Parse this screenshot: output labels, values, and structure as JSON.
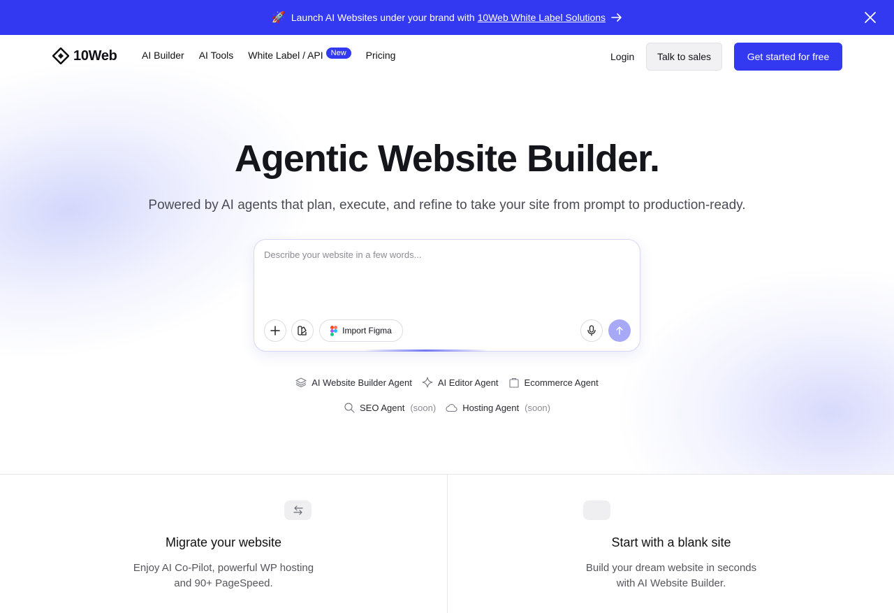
{
  "promo": {
    "text": "Launch AI Websites under your brand with",
    "link": "10Web White Label Solutions",
    "rocket": "🚀"
  },
  "nav": {
    "brand": "10Web",
    "links": [
      "AI Builder",
      "AI Tools",
      "White Label / API",
      "Pricing"
    ],
    "badge": "New",
    "login": "Login",
    "talk_to_sales": "Talk to sales",
    "get_started": "Get started for free"
  },
  "hero": {
    "title": "Agentic Website Builder.",
    "subtitle": "Powered by AI agents that plan, execute, and refine to take your site from prompt to production-ready."
  },
  "prompt": {
    "placeholder": "Describe your website in a few words...",
    "import_figma": "Import Figma"
  },
  "agents": {
    "row1": [
      "AI Website Builder Agent",
      "AI Editor Agent",
      "Ecommerce Agent"
    ],
    "row2": [
      "SEO Agent",
      "Hosting Agent"
    ],
    "soon": "(soon)"
  },
  "cards": [
    {
      "title": "Migrate your website",
      "desc_line1": "Enjoy AI Co-Pilot, powerful WP hosting",
      "desc_line2": "and 90+ PageSpeed."
    },
    {
      "title": "Start with a blank site",
      "desc_line1": "Build your dream website in seconds",
      "desc_line2": "with AI Website Builder."
    }
  ],
  "colors": {
    "accent": "#3339f1",
    "send_button": "#a7a9f6"
  },
  "icons": [
    "rocket-icon",
    "arrow-right-icon",
    "close-icon",
    "logo-icon",
    "plus-icon",
    "palette-icon",
    "figma-icon",
    "microphone-icon",
    "arrow-up-icon",
    "layers-icon",
    "sparkle-icon",
    "shopping-bag-icon",
    "search-icon",
    "cloud-icon",
    "swap-arrows-icon",
    "blank-icon"
  ]
}
